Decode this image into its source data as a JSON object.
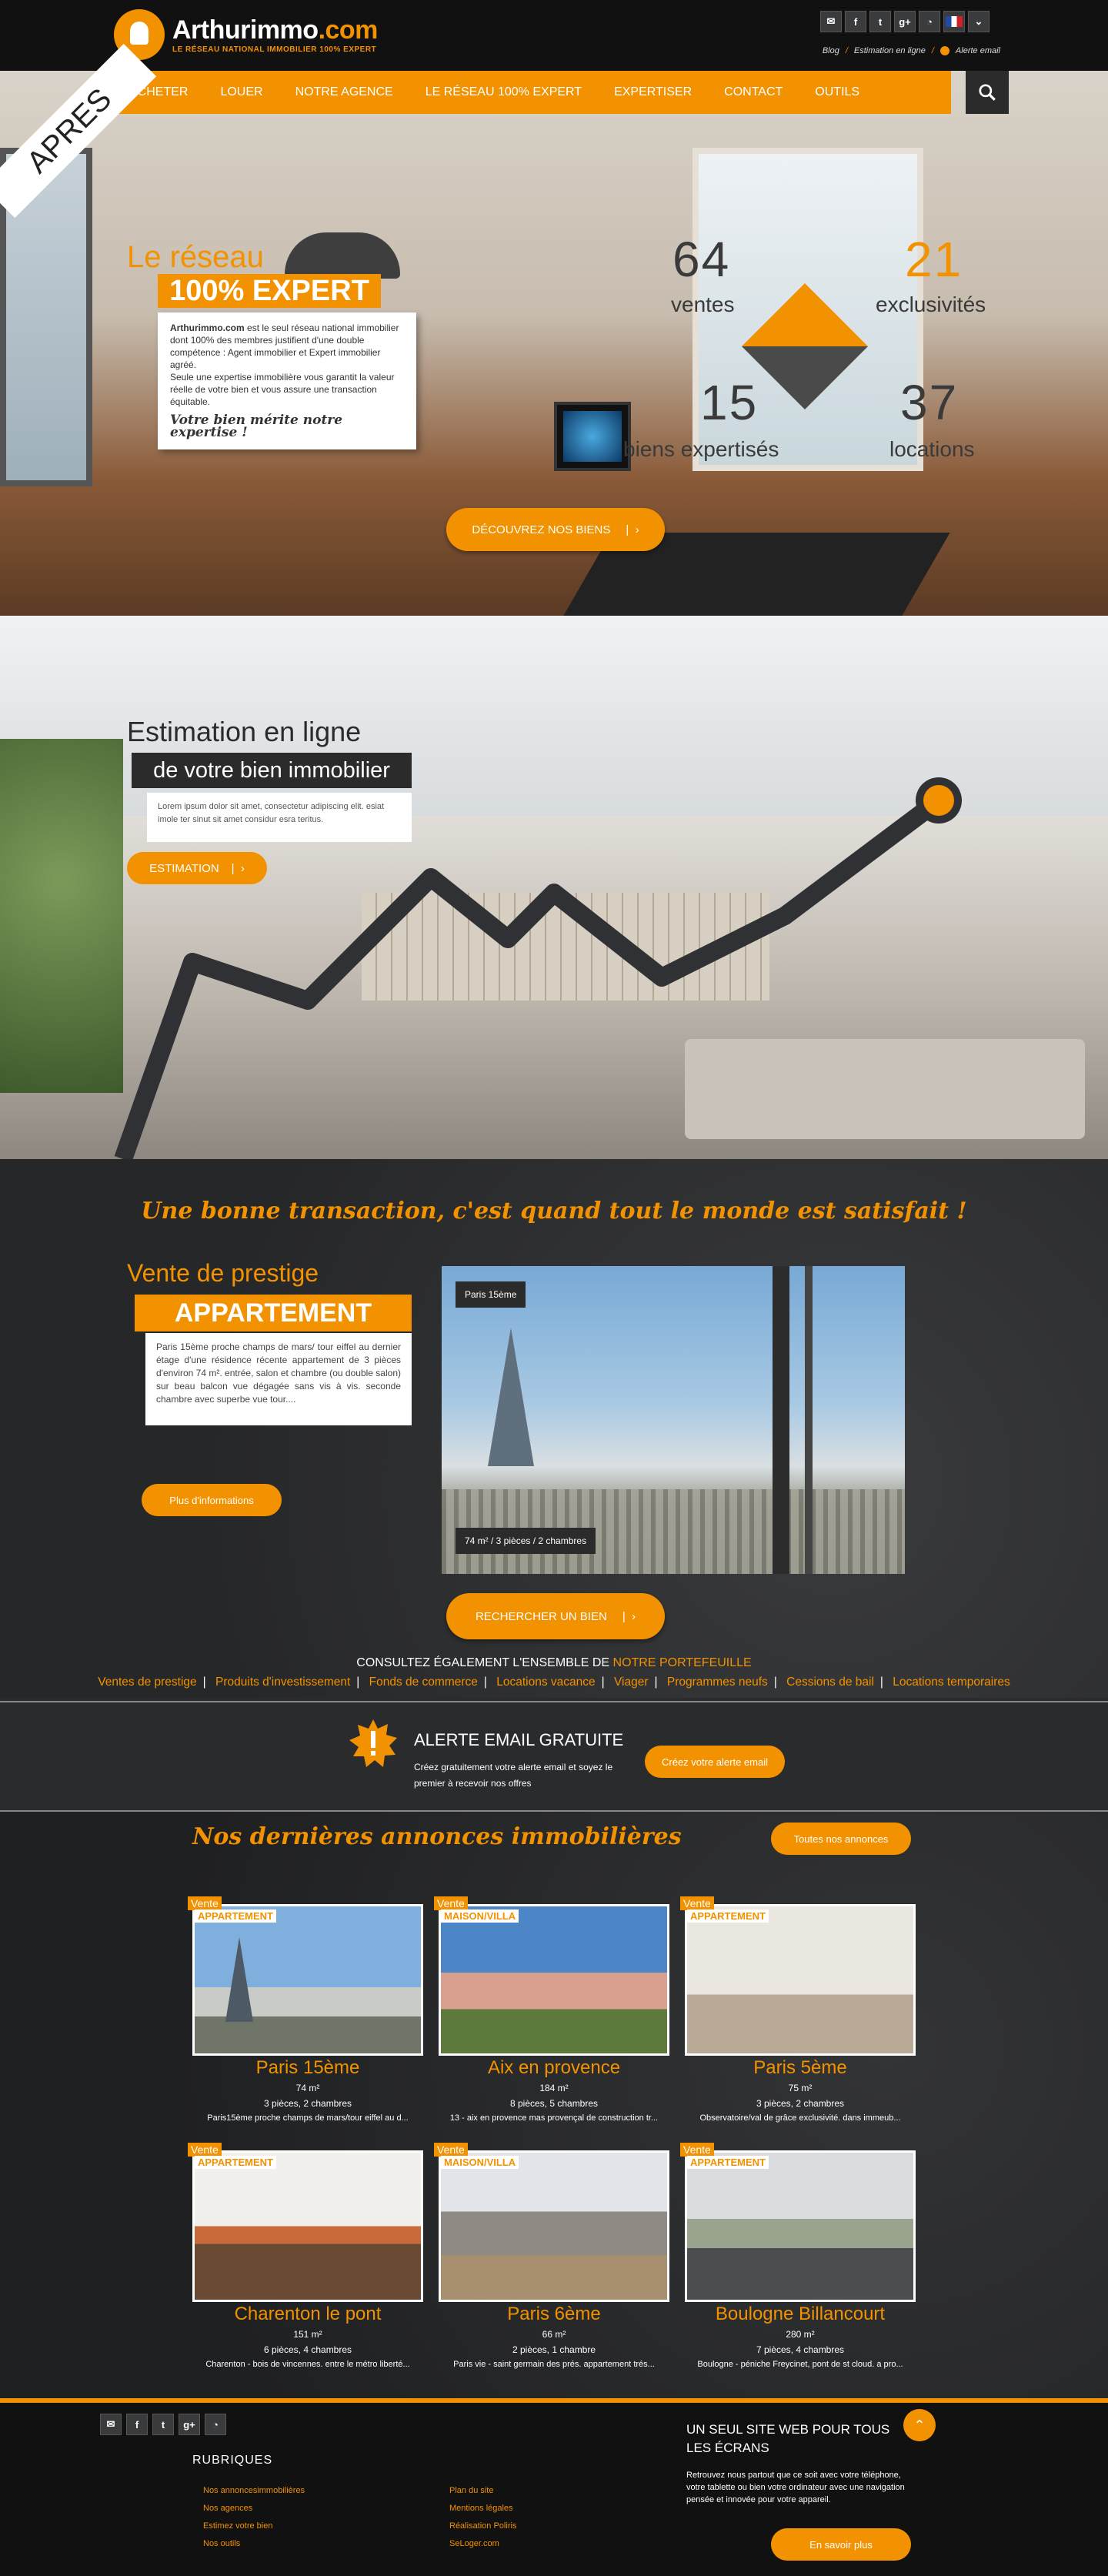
{
  "header": {
    "logo_name": "Arthurimmo",
    "logo_tld": ".com",
    "logo_tagline": "LE RÉSEAU NATIONAL IMMOBILIER 100% EXPERT",
    "social": [
      "email-icon",
      "facebook-icon",
      "twitter-icon",
      "google-plus-icon",
      "rss-icon"
    ],
    "links": [
      "Blog",
      "Estimation en ligne",
      "Alerte email"
    ]
  },
  "nav": {
    "items": [
      "ACHETER",
      "LOUER",
      "NOTRE AGENCE",
      "LE RÉSEAU 100% EXPERT",
      "EXPERTISER",
      "CONTACT",
      "OUTILS"
    ]
  },
  "hero1": {
    "corner": "APRES",
    "title": "Le réseau",
    "subtitle": "100% EXPERT",
    "brand": "Arthurimmo.com",
    "text1": " est le seul réseau national immobilier dont 100% des membres justifient d'une double compétence : Agent immobilier et Expert immobilier agréé.",
    "text2": "Seule une expertise immobilière vous garantit la valeur réelle de votre bien et vous assure une transaction équitable.",
    "signature": "Votre bien mérite notre expertise !",
    "stats": [
      {
        "value": "64",
        "label": "ventes"
      },
      {
        "value": "21",
        "label": "exclusivités"
      },
      {
        "value": "15",
        "label": "biens expertisés"
      },
      {
        "value": "37",
        "label": "locations"
      }
    ],
    "button": "DÉCOUVREZ NOS BIENS"
  },
  "hero2": {
    "title": "Estimation en ligne",
    "subtitle": "de votre bien immobilier",
    "text": "Lorem ipsum dolor sit amet, consectetur adipiscing elit. esiat imole ter sinut sit amet considur esra teritus.",
    "button": "ESTIMATION"
  },
  "prestige": {
    "slogan": "Une bonne transaction, c'est quand tout le monde est satisfait !",
    "title": "Vente de prestige",
    "subtitle": "APPARTEMENT",
    "text": "Paris 15ème proche champs de mars/ tour eiffel au dernier étage d'une résidence récente appartement de 3 pièces d'environ 74 m². entrée, salon et chambre (ou double salon) sur beau balcon vue dégagée sans vis à vis. seconde chambre avec superbe vue tour....",
    "button_info": "Plus d'informations",
    "photo_caption_top": "Paris 15ème",
    "photo_caption_bottom": "74 m² / 3 pièces / 2 chambres",
    "button_search": "RECHERCHER UN BIEN",
    "consult_prefix": "CONSULTEZ ÉGALEMENT L'ENSEMBLE DE ",
    "consult_link": "NOTRE PORTEFEUILLE",
    "categories": [
      "Ventes de prestige",
      "Produits d'investissement",
      "Fonds de commerce",
      "Locations vacance",
      "Viager",
      "Programmes neufs",
      "Cessions de bail",
      "Locations temporaires"
    ]
  },
  "alert": {
    "title": "ALERTE EMAIL GRATUITE",
    "text": "Créez gratuitement votre alerte email et soyez le premier à recevoir nos offres",
    "button": "Créez votre alerte email"
  },
  "listings": {
    "title": "Nos dernières annonces immobilières",
    "button": "Toutes nos annonces",
    "cards": [
      {
        "tag": "Vente",
        "type": "APPARTEMENT",
        "city": "Paris 15ème",
        "area": "74 m²",
        "rooms": "3 pièces, 2 chambres",
        "desc": "Paris15ème proche champs de mars/tour eiffel au d..."
      },
      {
        "tag": "Vente",
        "type": "MAISON/VILLA",
        "city": "Aix en provence",
        "area": "184 m²",
        "rooms": "8 pièces, 5 chambres",
        "desc": "13 - aix en provence mas provençal de construction tr..."
      },
      {
        "tag": "Vente",
        "type": "APPARTEMENT",
        "city": "Paris 5ème",
        "area": "75 m²",
        "rooms": "3 pièces, 2 chambres",
        "desc": "Observatoire/val de grâce exclusivité. dans immeub..."
      },
      {
        "tag": "Vente",
        "type": "APPARTEMENT",
        "city": "Charenton le pont",
        "area": "151 m²",
        "rooms": "6 pièces, 4 chambres",
        "desc": "Charenton - bois de vincennes. entre le métro liberté..."
      },
      {
        "tag": "Vente",
        "type": "MAISON/VILLA",
        "city": "Paris 6ème",
        "area": "66 m²",
        "rooms": "2 pièces, 1 chambre",
        "desc": "Paris vie - saint germain des prés. appartement trés..."
      },
      {
        "tag": "Vente",
        "type": "APPARTEMENT",
        "city": "Boulogne Billancourt",
        "area": "280 m²",
        "rooms": "7 pièces, 4 chambres",
        "desc": "Boulogne - péniche Freycinet, pont de st cloud. a pro..."
      }
    ]
  },
  "footer": {
    "rubriques": "RUBRIQUES",
    "col1": [
      "Nos annoncesimmobilières",
      "Nos agences",
      "Estimez votre bien",
      "Nos outils"
    ],
    "col2": [
      "Plan du site",
      "Mentions légales",
      "Réalisation Poliris",
      "SeLoger.com"
    ],
    "site_title": "UN SEUL SITE WEB POUR TOUS LES ÉCRANS",
    "site_text": "Retrouvez nous partout que ce soit avec votre téléphone, votre tablette ou bien votre ordinateur avec une navigation pensée et innovée pour votre appareil.",
    "button": "En savoir plus"
  },
  "colors": {
    "accent": "#f39200",
    "dark": "#2a2b2d"
  }
}
